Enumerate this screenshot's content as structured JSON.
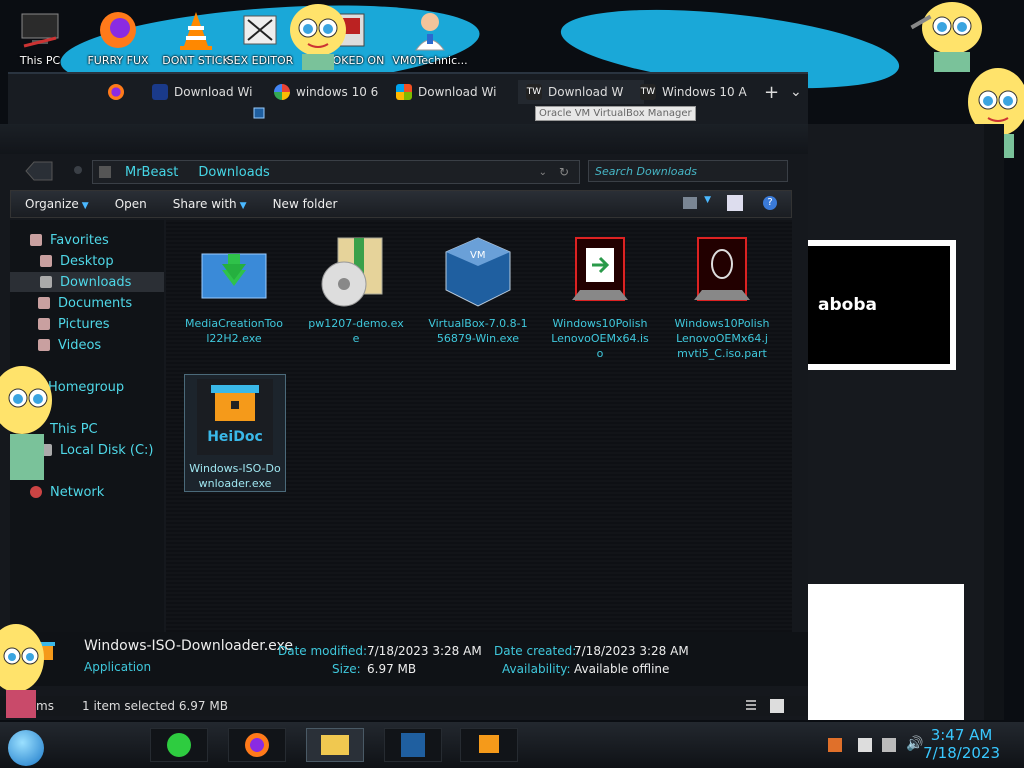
{
  "desktop": {
    "icons": [
      {
        "label": "This PC"
      },
      {
        "label": "FURRY FUX"
      },
      {
        "label": "DONT STICK"
      },
      {
        "label": "SEX EDITOR"
      },
      {
        "label": "HOOKED ON"
      },
      {
        "label": "VM0Technic..."
      }
    ]
  },
  "browser": {
    "tabs": [
      {
        "label": "Download Wi"
      },
      {
        "label": "windows 10 6"
      },
      {
        "label": "Download Wi"
      },
      {
        "label": "Download W"
      },
      {
        "label": "Windows 10 A"
      }
    ],
    "new_tab": "+",
    "tab_menu": "⌄",
    "tooltip": "Oracle VM VirtualBox Manager"
  },
  "explorer": {
    "breadcrumb": [
      "MrBeast",
      "Downloads"
    ],
    "search_placeholder": "Search Downloads",
    "toolbar": {
      "organize": "Organize",
      "open": "Open",
      "share_with": "Share with",
      "new_folder": "New folder"
    },
    "nav": [
      {
        "label": "Favorites"
      },
      {
        "label": "Desktop"
      },
      {
        "label": "Downloads"
      },
      {
        "label": "Documents"
      },
      {
        "label": "Pictures"
      },
      {
        "label": "Videos"
      },
      {
        "label": "Homegroup"
      },
      {
        "label": "This PC"
      },
      {
        "label": "Local Disk (C:)"
      },
      {
        "label": "Network"
      }
    ],
    "files": [
      {
        "label": "MediaCreationTool22H2.exe"
      },
      {
        "label": "pw1207-demo.exe"
      },
      {
        "label": "VirtualBox-7.0.8-156879-Win.exe"
      },
      {
        "label": "Windows10PolishLenovoOEMx64.iso"
      },
      {
        "label": "Windows10PolishLenovoOEMx64.jmvti5_C.iso.part"
      },
      {
        "label": "Windows-ISO-Downloader.exe"
      }
    ],
    "heidoc_logo": "HeiDoc",
    "details": {
      "name": "Windows-ISO-Downloader.exe",
      "type": "Application",
      "date_modified_label": "Date modified:",
      "date_modified": "7/18/2023 3:28 AM",
      "size_label": "Size:",
      "size": "6.97 MB",
      "date_created_label": "Date created:",
      "date_created": "7/18/2023 3:28 AM",
      "availability_label": "Availability:",
      "availability": "Available offline"
    },
    "status": {
      "items_fragment": "ms",
      "selected": "1 item selected  6.97 MB"
    }
  },
  "side_window": {
    "title": "aboba"
  },
  "taskbar": {
    "time": "3:47 AM",
    "date": "7/18/2023"
  },
  "colors": {
    "accent": "#46d6e6",
    "link": "#3fc8dc",
    "clock": "#39c8ff"
  }
}
